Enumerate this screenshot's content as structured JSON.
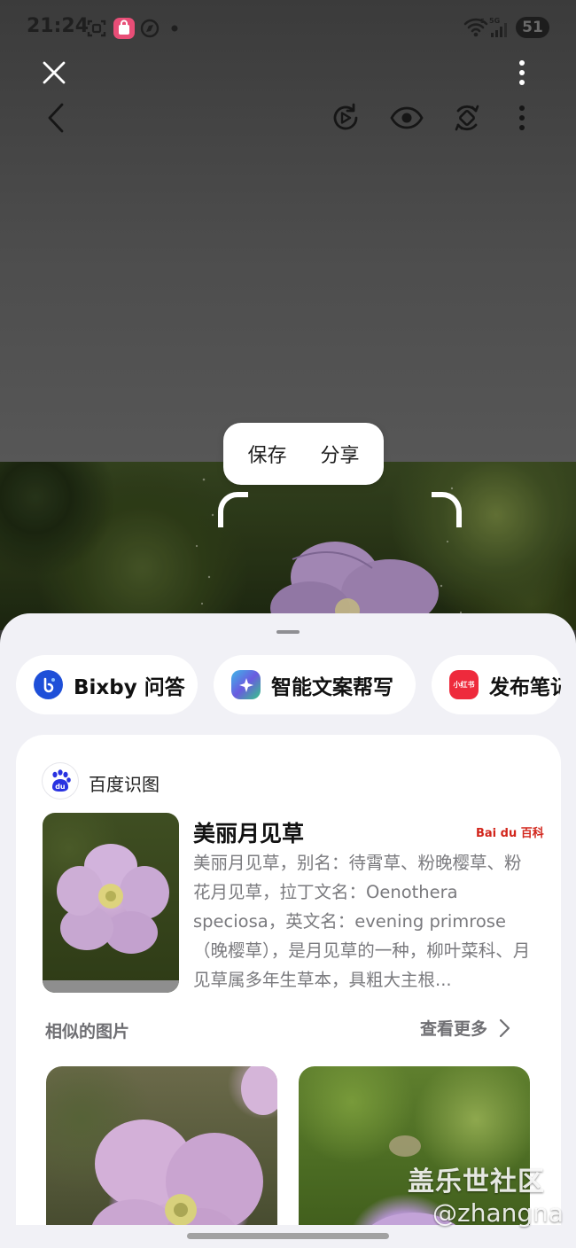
{
  "status_bar": {
    "time": "21:24",
    "battery": "51"
  },
  "toolbar": {
    "close_icon": "close-icon",
    "menu_icon": "more-vertical-icon",
    "back_icon": "chevron-left-icon",
    "actions": [
      "replay-icon",
      "eye-icon",
      "rotate-icon",
      "more-vertical-icon"
    ]
  },
  "popup": {
    "save_label": "保存",
    "share_label": "分享"
  },
  "chips": [
    {
      "label": "Bixby 问答",
      "icon": "bixby-icon",
      "color": "#1e4fd8"
    },
    {
      "label": "智能文案帮写",
      "icon": "ai-writer-icon",
      "color": "#3fb8e8"
    },
    {
      "label": "发布笔记",
      "icon": "xiaohongshu-icon",
      "icon_text": "小红书",
      "color": "#ee2a3c"
    }
  ],
  "result_card": {
    "source_name": "百度识图",
    "title": "美丽月见草",
    "badge": "Bai du 百科",
    "description": "美丽月见草，别名：待霄草、粉晚樱草、粉花月见草，拉丁文名：Oenothera speciosa，英文名：evening primrose（晚樱草），是月见草的一种，柳叶菜科、月见草属多年生草本，具粗大主根...",
    "similar_title": "相似的图片",
    "more_label": "查看更多"
  },
  "watermark": {
    "main": "盖乐世社区",
    "sub": "@zhangna"
  }
}
